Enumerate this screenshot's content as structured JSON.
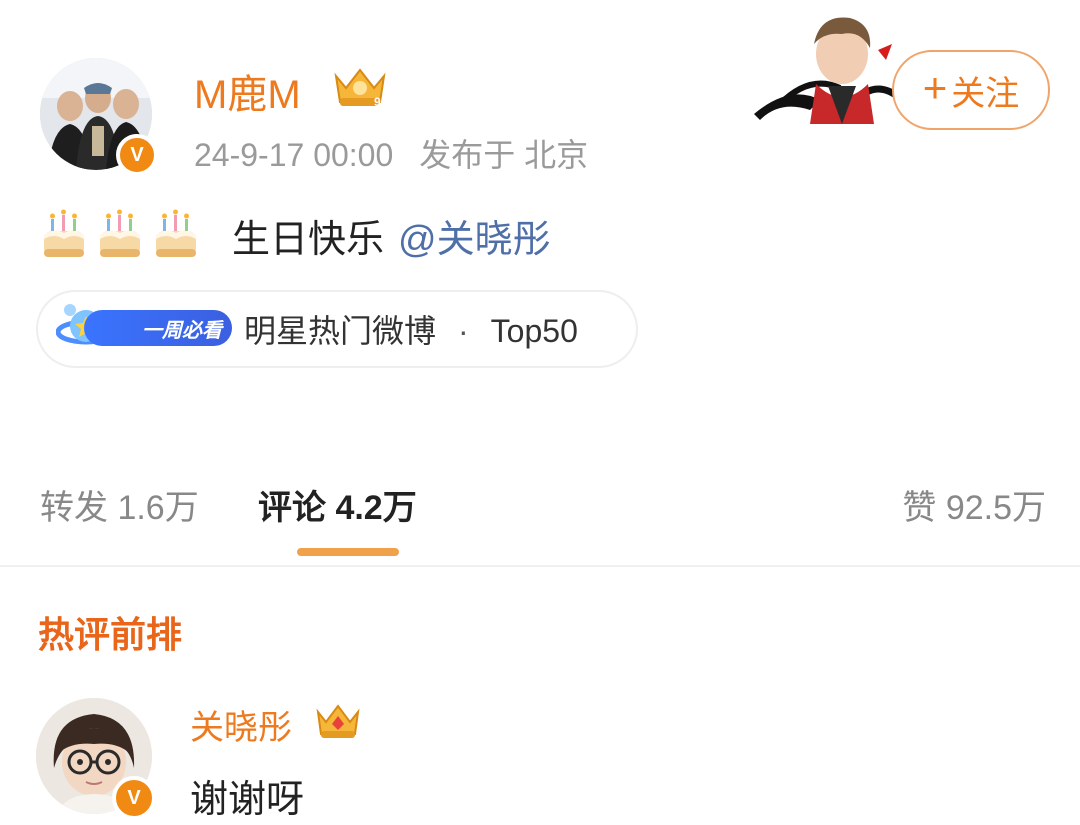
{
  "post": {
    "author": "M鹿M",
    "timestamp": "24-9-17 00:00",
    "location": "发布于 北京",
    "follow_label": "关注",
    "follow_plus": "+",
    "verified_badge": "V",
    "emojis": [
      "cake-icon",
      "cake-icon",
      "cake-icon"
    ],
    "text": "生日快乐",
    "mention": "@关晓彤",
    "hot_tag": {
      "badge_label": "一周必看",
      "text": "明星热门微博",
      "separator": "·",
      "rank": "Top50"
    }
  },
  "tabs": {
    "repost": "转发 1.6万",
    "comment": "评论 4.2万",
    "like": "赞 92.5万"
  },
  "hot_comments": {
    "title": "热评前排",
    "items": [
      {
        "name": "关晓彤",
        "text": "谢谢呀",
        "verified_badge": "V"
      }
    ]
  },
  "colors": {
    "accent": "#ee7a1f",
    "mention": "#4f6fa8",
    "underline": "#f0a14a",
    "hot_title": "#e8651a"
  }
}
